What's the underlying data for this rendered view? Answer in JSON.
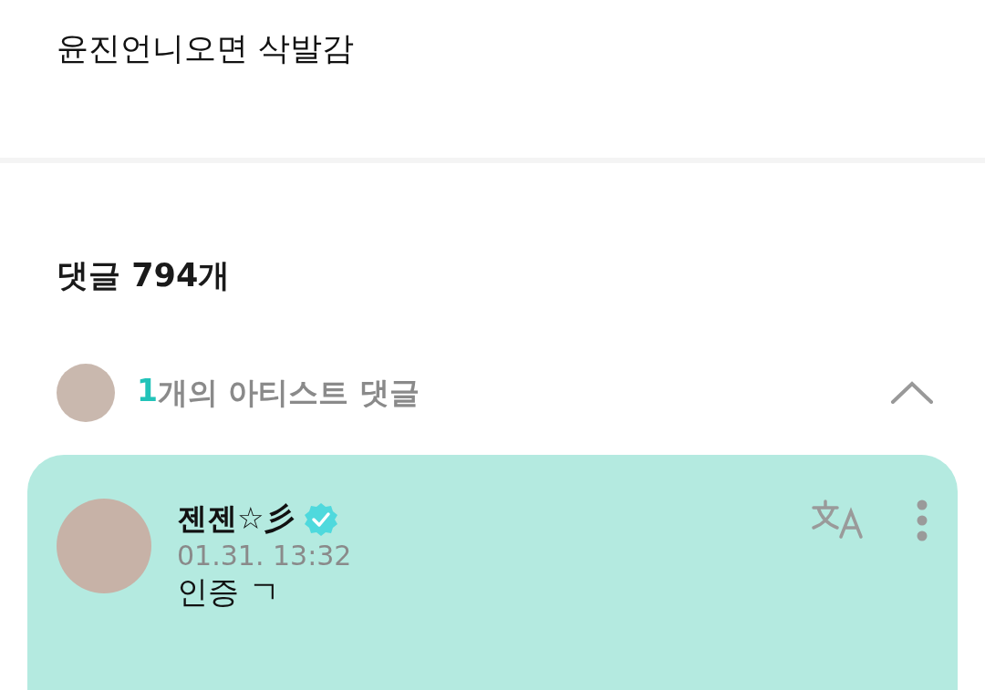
{
  "post": {
    "text": "윤진언니오면 삭발감"
  },
  "comments_header": {
    "title": "댓글 794개"
  },
  "artist_comments": {
    "count": "1",
    "label": "개의 아티스트 댓글",
    "expanded": true
  },
  "comments": [
    {
      "author": "젠젠☆彡",
      "verified": true,
      "time": "01.31. 13:32",
      "text": "인증 ㄱ"
    }
  ]
}
